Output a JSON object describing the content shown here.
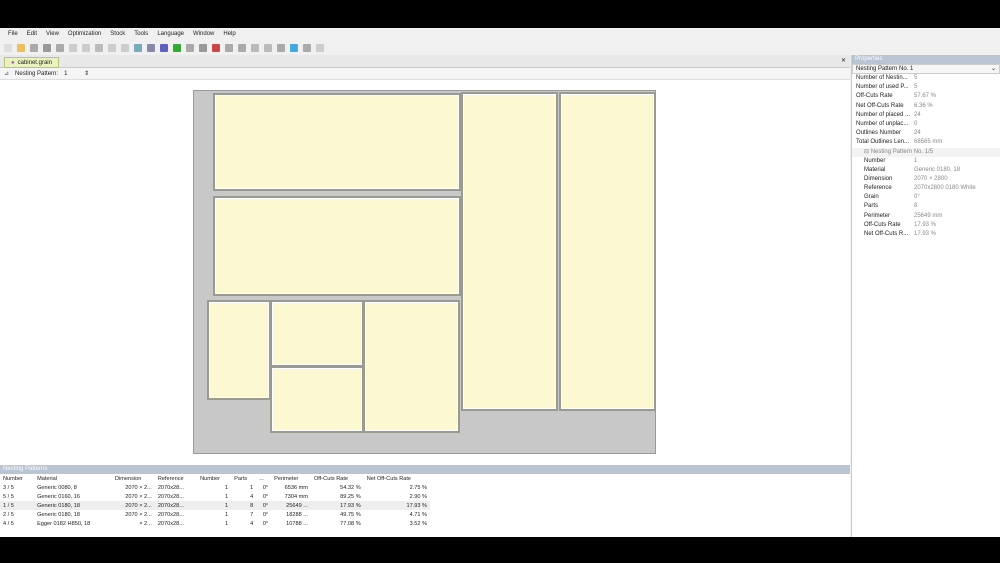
{
  "menu": [
    "File",
    "Edit",
    "View",
    "Optimization",
    "Stock",
    "Tools",
    "Language",
    "Window",
    "Help"
  ],
  "tab": {
    "label": "cabinet.grain"
  },
  "nesting_bar": {
    "label": "Nesting Pattern:",
    "value": "1"
  },
  "properties": {
    "title": "Properties",
    "selector": "Nesting Pattern No. 1",
    "rows": [
      [
        "Number of Nestin...",
        "5"
      ],
      [
        "Number of used P...",
        "5"
      ],
      [
        "Off-Cuts Rate",
        "57.67 %"
      ],
      [
        "Net Off-Cuts Rate",
        "6.36 %"
      ],
      [
        "Number of placed ...",
        "24"
      ],
      [
        "Number of unplac...",
        "0"
      ],
      [
        "Outlines Number",
        "24"
      ],
      [
        "Total Outlines Len...",
        "68565 mm"
      ]
    ],
    "group": "Nesting Pattern No. 1/5",
    "sub_rows": [
      [
        "Number",
        "1"
      ],
      [
        "Material",
        "Generic 0180, 18"
      ],
      [
        "Dimension",
        "2070 × 2800"
      ],
      [
        "Reference",
        "2070x2800 0180 White"
      ],
      [
        "Grain",
        "0°"
      ],
      [
        "Parts",
        "8"
      ],
      [
        "Perimeter",
        "25649 mm"
      ],
      [
        "Off-Cuts Rate",
        "17.93 %"
      ],
      [
        "Net Off-Cuts R...",
        "17.93 %"
      ]
    ]
  },
  "bottom": {
    "title": "Nesting Patterns",
    "headers": [
      "Number",
      "Material",
      "Dimension",
      "Reference",
      "Number",
      "Parts",
      "...",
      "Perimeter",
      "Off-Cuts Rate",
      "Net Off-Cuts Rate"
    ],
    "rows": [
      [
        "3 / 5",
        "Generic 0080, 8",
        "2070 × 2...",
        "2070x28...",
        "1",
        "1",
        "0°",
        "6536 mm",
        "54.32 %",
        "2.75 %"
      ],
      [
        "5 / 5",
        "Generic 0160, 16",
        "2070 × 2...",
        "2070x28...",
        "1",
        "4",
        "0°",
        "7304 mm",
        "89.25 %",
        "2.90 %"
      ],
      [
        "1 / 5",
        "Generic 0180, 18",
        "2070 × 2...",
        "2070x28...",
        "1",
        "8",
        "0°",
        "25649 ...",
        "17.93 %",
        "17.93 %"
      ],
      [
        "2 / 5",
        "Generic 0180, 18",
        "2070 × 2...",
        "2070x28...",
        "1",
        "7",
        "0°",
        "18288 ...",
        "49.75 %",
        "4.71 %"
      ],
      [
        "4 / 5",
        "Egger 0182 H850, 18",
        "× 2...",
        "2070x28...",
        "1",
        "4",
        "0°",
        "10788 ...",
        "77.08 %",
        "3.52 %"
      ]
    ]
  }
}
